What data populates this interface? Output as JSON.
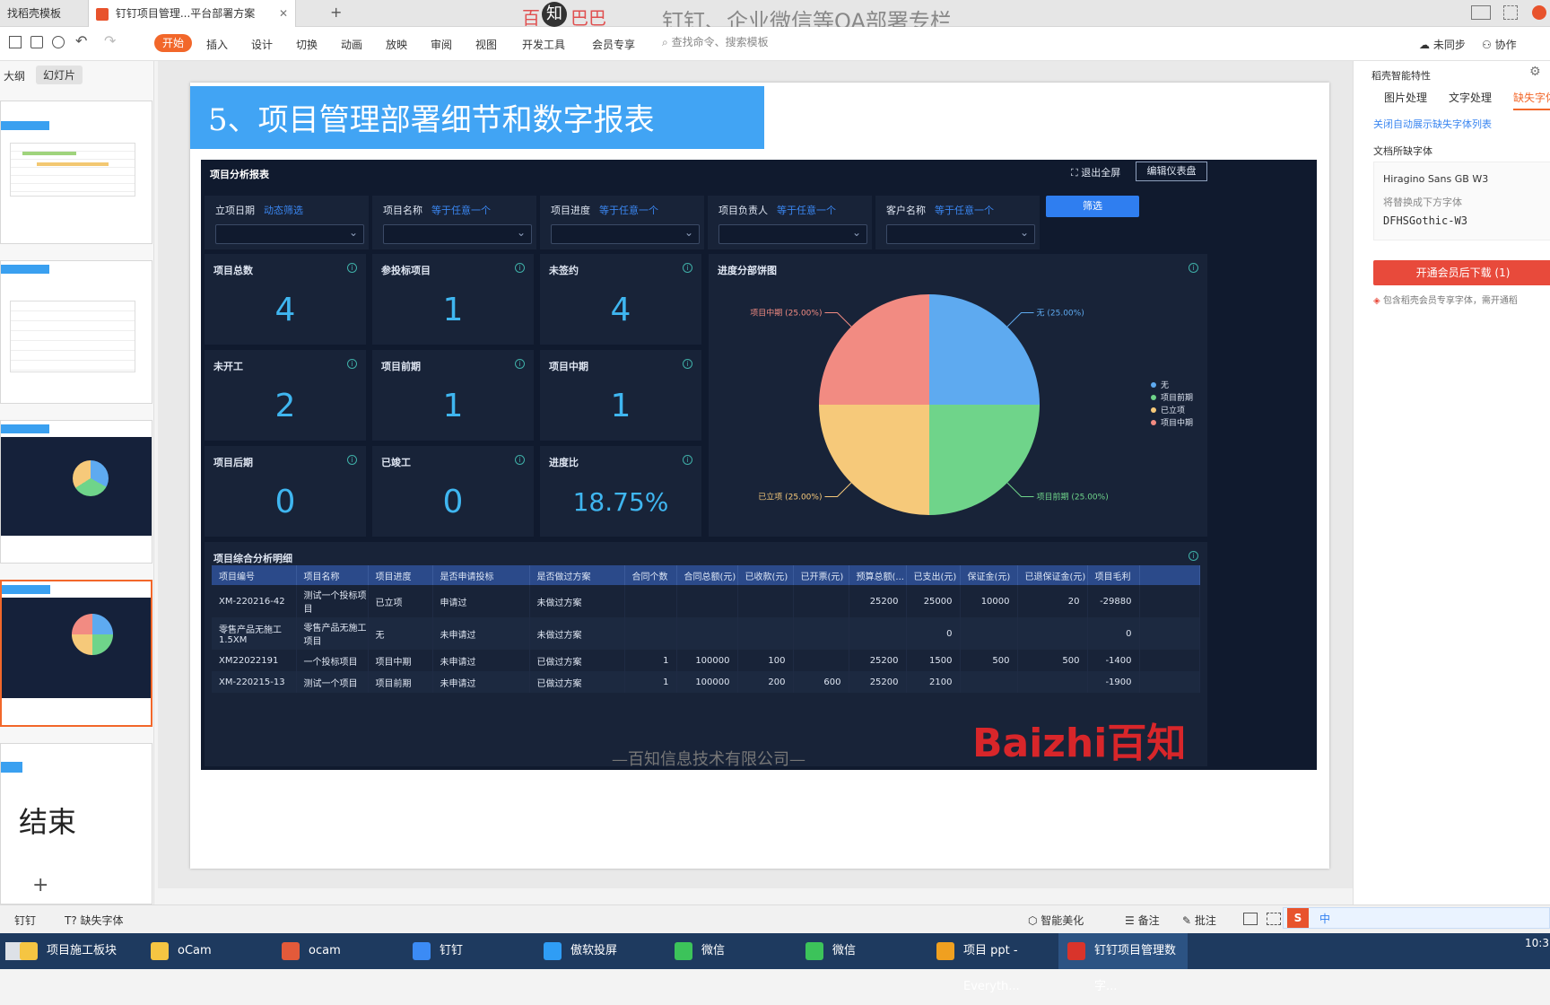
{
  "tabs": [
    {
      "label": "找稻壳模板"
    },
    {
      "label": "钉钉项目管理...平台部署方案"
    }
  ],
  "watermark": {
    "brand_a": "百",
    "brand_b": "知",
    "brand_c": "巴巴",
    "text": "钉钉、企业微信等OA部署专栏"
  },
  "toolbar": {
    "start": "开始",
    "menus": [
      "插入",
      "设计",
      "切换",
      "动画",
      "放映",
      "审阅",
      "视图",
      "开发工具",
      "会员专享"
    ],
    "search": "查找命令、搜索模板",
    "sync": "未同步",
    "collab": "协作"
  },
  "leftpane": {
    "tab_outline": "大纲",
    "tab_slides": "幻灯片",
    "end_text": "结束"
  },
  "slide": {
    "title": "5、项目管理部署细节和数字报表",
    "footer": "—百知信息技术有限公司—",
    "logo": "Baizhi百知",
    "dash": {
      "title": "项目分析报表",
      "exit_full": "退出全屏",
      "edit": "编辑仪表盘",
      "filter_btn": "筛选",
      "filters": [
        {
          "label": "立项日期",
          "value": "动态筛选"
        },
        {
          "label": "项目名称",
          "value": "等于任意一个"
        },
        {
          "label": "项目进度",
          "value": "等于任意一个"
        },
        {
          "label": "项目负责人",
          "value": "等于任意一个"
        },
        {
          "label": "客户名称",
          "value": "等于任意一个"
        }
      ],
      "kpis": [
        {
          "label": "项目总数",
          "value": "4"
        },
        {
          "label": "参投标项目",
          "value": "1"
        },
        {
          "label": "未签约",
          "value": "4"
        },
        {
          "label": "未开工",
          "value": "2"
        },
        {
          "label": "项目前期",
          "value": "1"
        },
        {
          "label": "项目中期",
          "value": "1"
        },
        {
          "label": "项目后期",
          "value": "0"
        },
        {
          "label": "已竣工",
          "value": "0"
        },
        {
          "label": "进度比",
          "value": "18.75%"
        }
      ],
      "pie_title": "进度分部饼图",
      "table_title": "项目综合分析明细",
      "table": {
        "headers": [
          "项目编号",
          "项目名称",
          "项目进度",
          "是否申请投标",
          "是否做过方案",
          "合同个数",
          "合同总额(元)",
          "已收款(元)",
          "已开票(元)",
          "预算总额(...",
          "已支出(元)",
          "保证金(元)",
          "已退保证金(元)",
          "项目毛利"
        ],
        "rows": [
          [
            "XM-220216-42",
            "测试一个投标项目",
            "已立项",
            "申请过",
            "未做过方案",
            "",
            "",
            "",
            "",
            "25200",
            "25000",
            "10000",
            "20",
            "-29880"
          ],
          [
            "零售产品无施工1.5XM",
            "零售产品无施工项目",
            "无",
            "未申请过",
            "未做过方案",
            "",
            "",
            "",
            "",
            "",
            "0",
            "",
            "",
            "0"
          ],
          [
            "XM22022191",
            "一个投标项目",
            "项目中期",
            "未申请过",
            "已做过方案",
            "1",
            "100000",
            "100",
            "",
            "25200",
            "1500",
            "500",
            "500",
            "-1400"
          ],
          [
            "XM-220215-13",
            "测试一个项目",
            "项目前期",
            "未申请过",
            "已做过方案",
            "1",
            "100000",
            "200",
            "600",
            "25200",
            "2100",
            "",
            "",
            "-1900"
          ]
        ]
      }
    }
  },
  "chart_data": {
    "type": "pie",
    "title": "进度分部饼图",
    "categories": [
      "无",
      "项目前期",
      "已立项",
      "项目中期"
    ],
    "values": [
      25,
      25,
      25,
      25
    ],
    "labels": [
      "无 (25.00%)",
      "项目前期 (25.00%)",
      "已立项 (25.00%)",
      "项目中期 (25.00%)"
    ],
    "colors": [
      "#5eaaf0",
      "#6fd48a",
      "#f6c97a",
      "#f28b82"
    ],
    "legend": "right"
  },
  "rightpane": {
    "title": "稻壳智能特性",
    "tabs": [
      "图片处理",
      "文字处理",
      "缺失字体"
    ],
    "close_link": "关闭自动展示缺失字体列表",
    "missing_label": "文档所缺字体",
    "font_name": "Hiragino Sans GB W3",
    "replace_hint": "将替换成下方字体",
    "replace_font": "DFHSGothic-W3",
    "download_btn": "开通会员后下载 (1)",
    "note": "包含稻壳会员专享字体，需开通稻"
  },
  "status": {
    "dingtalk": "钉钉",
    "missing_font": "缺失字体",
    "beautify": "智能美化",
    "notes": "备注",
    "comments": "批注"
  },
  "taskbar": [
    {
      "label": "项目施工板块",
      "color": "#f5c542"
    },
    {
      "label": "oCam",
      "color": "#f5c542"
    },
    {
      "label": "ocam",
      "color": "#e35a3a"
    },
    {
      "label": "钉钉",
      "color": "#3b8bf5"
    },
    {
      "label": "傲软投屏",
      "color": "#2f9df5"
    },
    {
      "label": "微信",
      "color": "#3cc35a"
    },
    {
      "label": "微信",
      "color": "#3cc35a"
    },
    {
      "label": "项目 ppt - Everyth...",
      "color": "#f0a020"
    },
    {
      "label": "钉钉项目管理数字...",
      "color": "#d9342b"
    }
  ],
  "tray": {
    "time": "10:3",
    "ime": "中"
  }
}
